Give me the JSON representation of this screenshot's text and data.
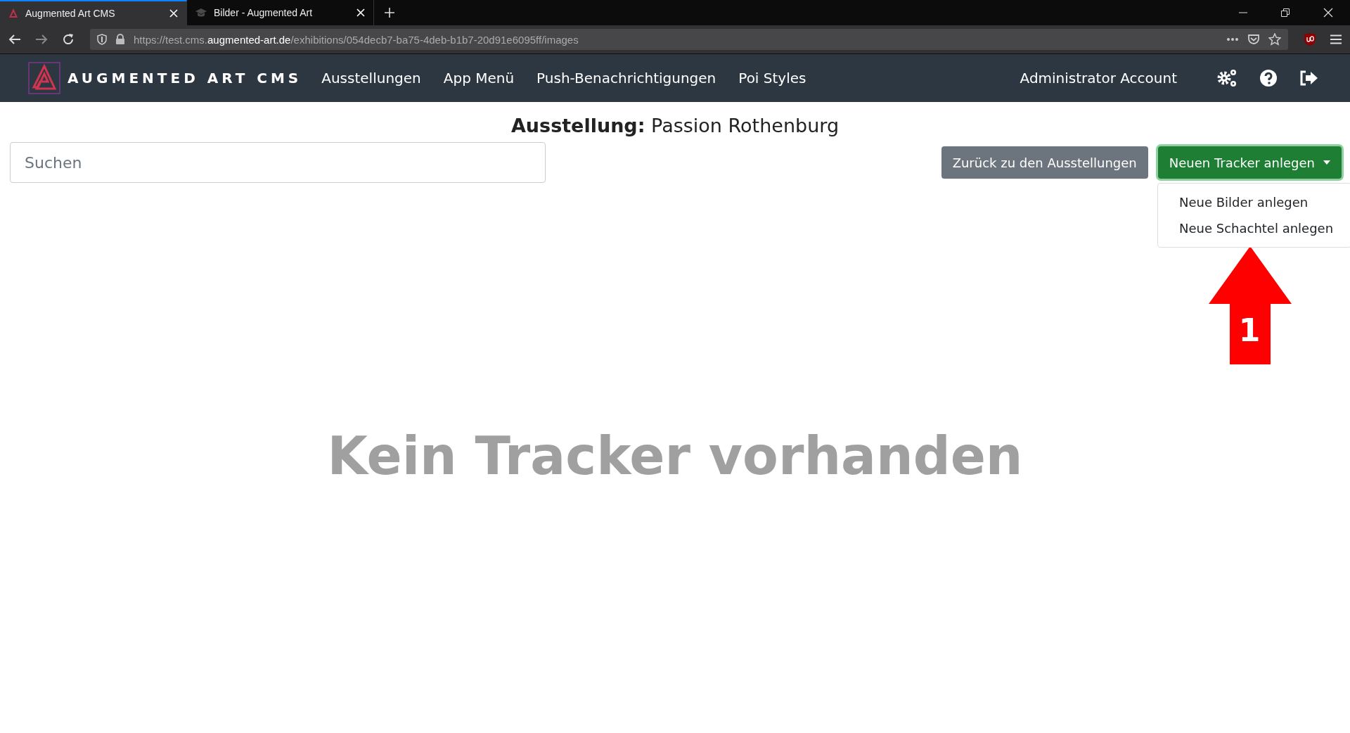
{
  "browser": {
    "tabs": [
      {
        "title": "Augmented Art CMS",
        "selected": true
      },
      {
        "title": "Bilder - Augmented Art",
        "selected": false
      }
    ],
    "url": {
      "scheme": "https://test.cms.",
      "domain": "augmented-art.de",
      "path": "/exhibitions/054decb7-ba75-4deb-b1b7-20d91e6095ff/images"
    }
  },
  "navbar": {
    "brand": "AUGMENTED ART CMS",
    "links": [
      "Ausstellungen",
      "App Menü",
      "Push-Benachrichtigungen",
      "Poi Styles"
    ],
    "account": "Administrator Account"
  },
  "page": {
    "heading": "**Ausstellung:** Passion Rothenburg",
    "search": {
      "placeholder": "Suchen"
    },
    "back_button": "Zurück zu den Ausstellungen",
    "dropdown": {
      "label": "Neuen Tracker anlegen",
      "expanded": true,
      "items": [
        "Neue Bilder anlegen",
        "Neue Schachtel anlegen"
      ]
    },
    "annotation": {
      "number": "1"
    },
    "empty_message": "Kein Tracker vorhanden"
  }
}
